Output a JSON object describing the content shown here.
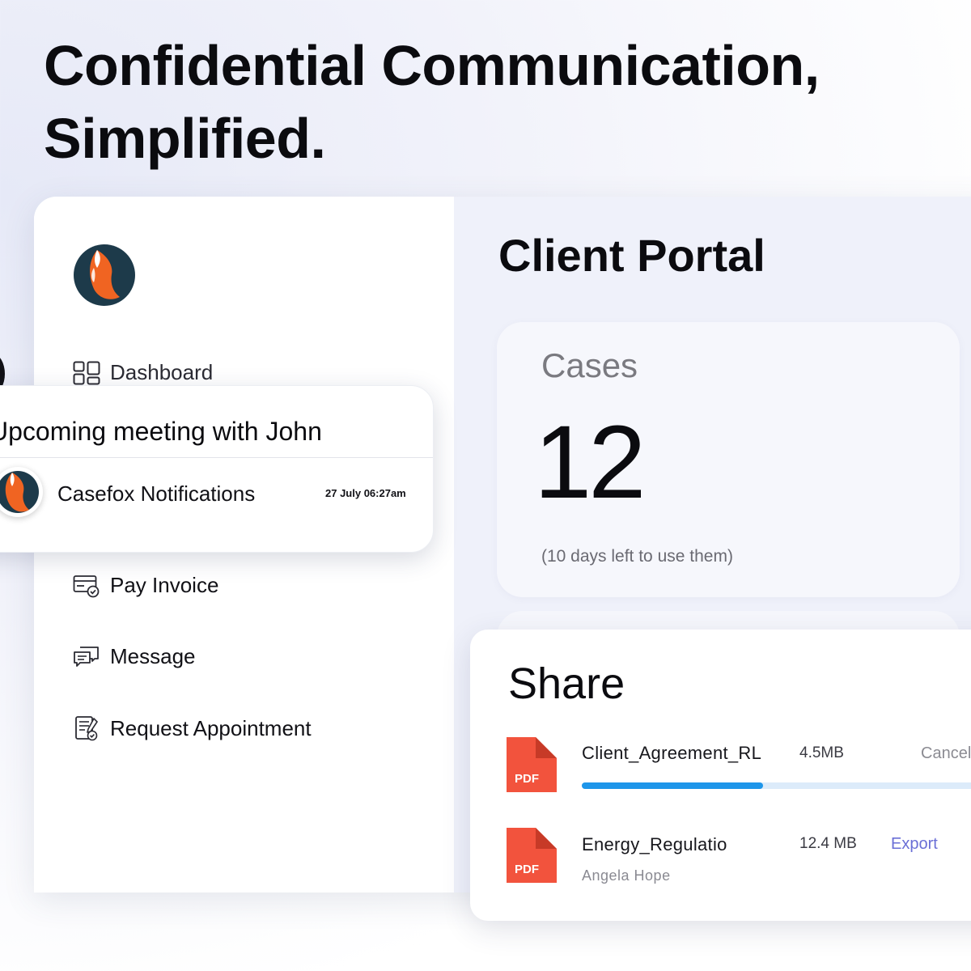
{
  "headline": {
    "line1": "Confidential Communication,",
    "line2": "Simplified."
  },
  "sidebar": {
    "logo_icon": "casefox-fox-logo",
    "items": [
      {
        "label": "Dashboard",
        "icon": "dashboard-grid-icon"
      },
      {
        "label": "Pay Invoice",
        "icon": "invoice-card-icon"
      },
      {
        "label": "Message",
        "icon": "chat-bubbles-icon"
      },
      {
        "label": "Request Appointment",
        "icon": "appointment-form-icon"
      }
    ]
  },
  "notification": {
    "title": "Upcoming meeting with John",
    "app_name": "Casefox Notifications",
    "time": "27 July 06:27am"
  },
  "main": {
    "title": "Client Portal",
    "cases": {
      "label": "Cases",
      "count": "12",
      "note": "(10 days left to use them)"
    }
  },
  "share": {
    "title": "Share",
    "files": [
      {
        "name": "Client_Agreement_RL",
        "size": "4.5MB",
        "action": "Cancel",
        "progress": 0.43,
        "file_type": "PDF"
      },
      {
        "name": "Energy_Regulatio",
        "size": "12.4 MB",
        "action": "Export",
        "owner": "Angela Hope",
        "file_type": "PDF"
      }
    ]
  },
  "colors": {
    "accent_blue": "#1e96ea",
    "progress_track": "#dcebfa",
    "export_link": "#6a6fd6",
    "pdf_red": "#f2533d",
    "logo_navy": "#1d3a4a",
    "logo_orange": "#f06422"
  }
}
